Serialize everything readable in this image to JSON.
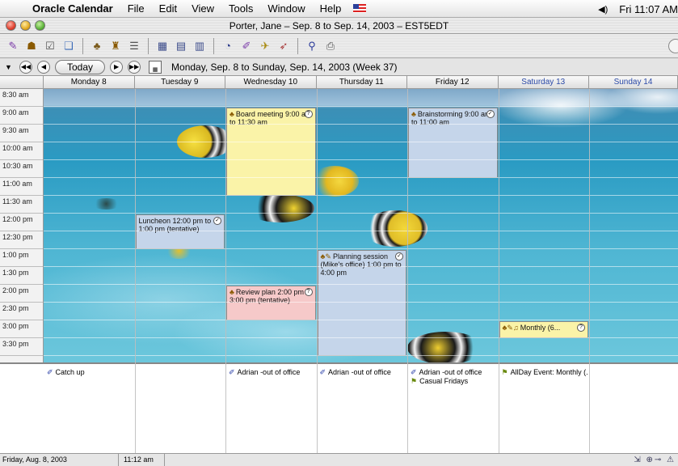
{
  "menubar": {
    "app_name": "Oracle Calendar",
    "items": [
      "File",
      "Edit",
      "View",
      "Tools",
      "Window",
      "Help"
    ],
    "clock": "Fri 11:07 AM"
  },
  "window": {
    "title": "Porter, Jane – Sep. 8 to Sep. 14, 2003 – EST5EDT"
  },
  "nav": {
    "today_label": "Today",
    "range": "Monday, Sep. 8 to Sunday, Sep. 14, 2003 (Week 37)"
  },
  "days": [
    {
      "label": "Monday 8",
      "weekend": false
    },
    {
      "label": "Tuesday 9",
      "weekend": false
    },
    {
      "label": "Wednesday 10",
      "weekend": false
    },
    {
      "label": "Thursday 11",
      "weekend": false
    },
    {
      "label": "Friday 12",
      "weekend": false
    },
    {
      "label": "Saturday 13",
      "weekend": true
    },
    {
      "label": "Sunday 14",
      "weekend": true
    }
  ],
  "times": [
    "8:30 am",
    "9:00 am",
    "9:30 am",
    "10:00 am",
    "10:30 am",
    "11:00 am",
    "11:30 am",
    "12:00 pm",
    "12:30 pm",
    "1:00 pm",
    "1:30 pm",
    "2:00 pm",
    "2:30 pm",
    "3:00 pm",
    "3:30 pm"
  ],
  "appointments": [
    {
      "id": "board-meeting",
      "day": 2,
      "start": 9.0,
      "end": 11.5,
      "color": "yellow",
      "icons": "group",
      "text": "Board meeting 9:00 am to 11:30 am",
      "status": "?"
    },
    {
      "id": "brainstorming",
      "day": 4,
      "start": 9.0,
      "end": 11.0,
      "color": "blue",
      "icons": "group",
      "text": "Brainstorming 9:00 am to 11:00 am",
      "status": "✓"
    },
    {
      "id": "luncheon",
      "day": 1,
      "start": 12.0,
      "end": 13.0,
      "color": "blue",
      "icons": "",
      "text": "Luncheon 12:00 pm to 1:00 pm (tentative)",
      "status": "✓"
    },
    {
      "id": "planning-session",
      "day": 3,
      "start": 13.0,
      "end": 16.0,
      "color": "blue",
      "icons": "group-note",
      "text": "Planning session (Mike's office) 1:00 pm to 4:00 pm",
      "status": "✓"
    },
    {
      "id": "review-plan",
      "day": 2,
      "start": 14.0,
      "end": 15.0,
      "color": "pink",
      "icons": "group",
      "text": "Review plan 2:00 pm to 3:00 pm (tentative)",
      "status": "?"
    },
    {
      "id": "monthly",
      "day": 5,
      "start": 15.0,
      "end": 15.5,
      "color": "yellow",
      "icons": "group-note-bell",
      "text": "Monthly (6...",
      "status": "?"
    }
  ],
  "untimed": [
    {
      "day": 0,
      "row": 0,
      "kind": "pin",
      "text": "Catch up"
    },
    {
      "day": 2,
      "row": 0,
      "kind": "pin",
      "text": "Adrian -out of office"
    },
    {
      "day": 3,
      "row": 0,
      "kind": "pin",
      "text": "Adrian -out of office"
    },
    {
      "day": 4,
      "row": 0,
      "kind": "pin",
      "text": "Adrian -out of office"
    },
    {
      "day": 4,
      "row": 1,
      "kind": "hat",
      "text": "Casual Fridays"
    },
    {
      "day": 5,
      "row": 0,
      "kind": "hat",
      "text": "AllDay Event: Monthly (..."
    }
  ],
  "status": {
    "date": "Friday, Aug. 8, 2003",
    "time": "11:12 am"
  }
}
